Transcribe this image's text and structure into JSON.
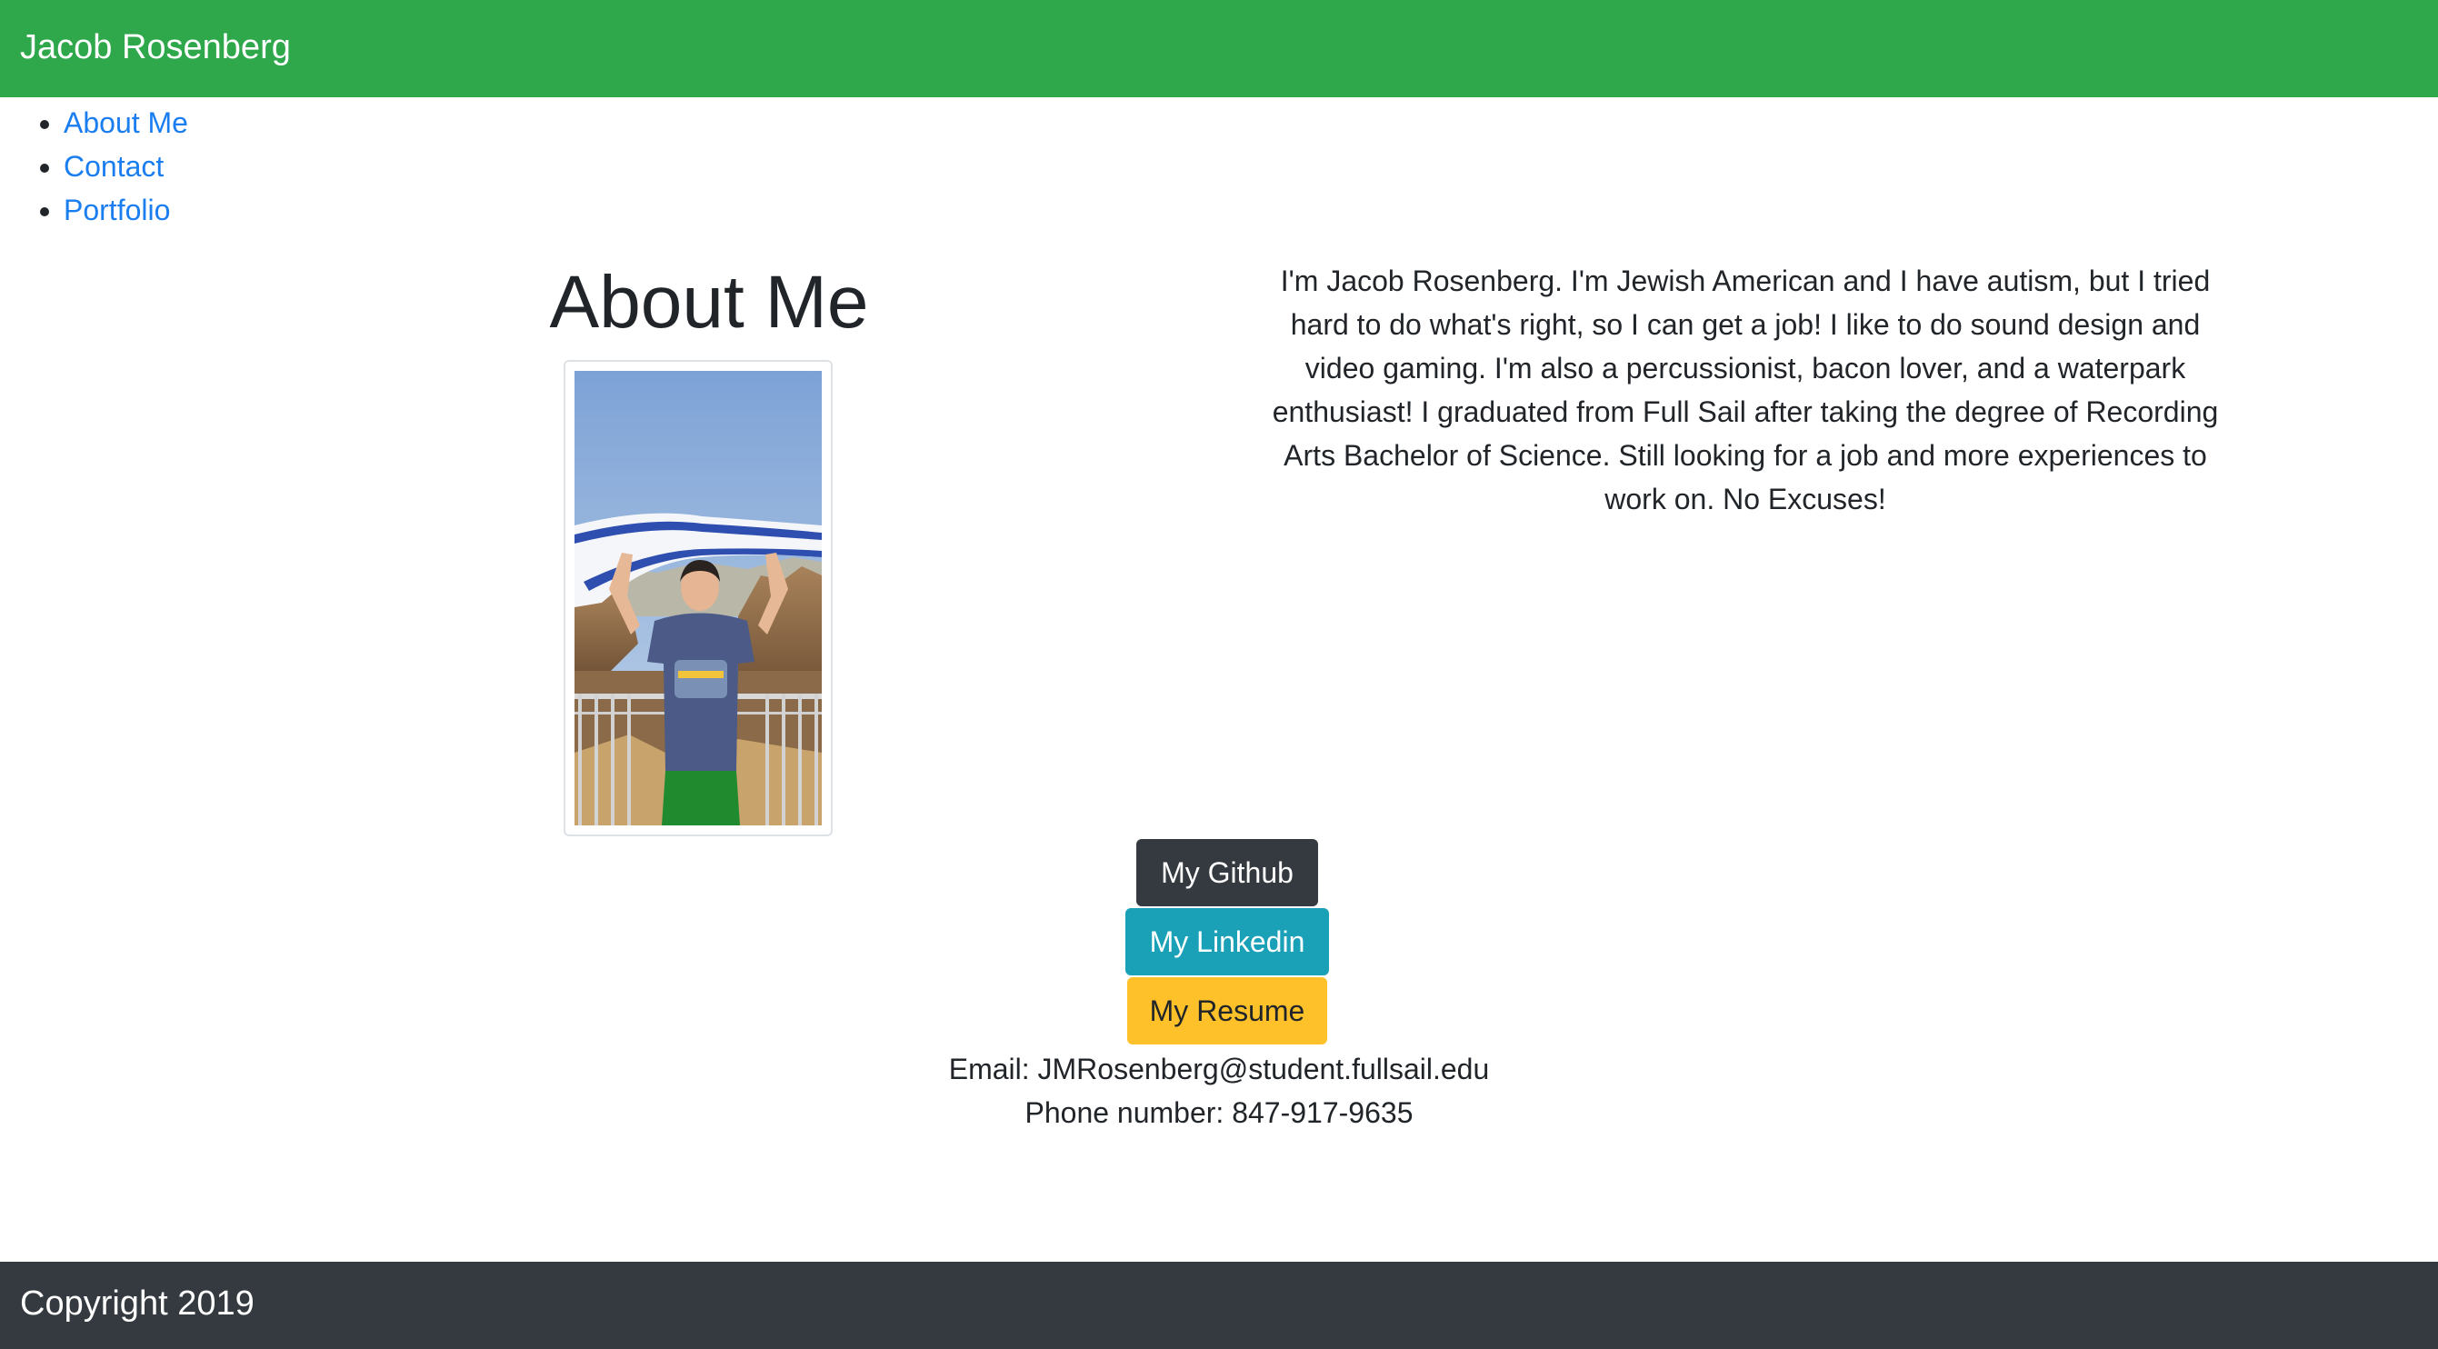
{
  "header": {
    "brand": "Jacob Rosenberg",
    "background_color": "#2fa84c"
  },
  "nav": {
    "items": [
      {
        "label": "About Me"
      },
      {
        "label": "Contact"
      },
      {
        "label": "Portfolio"
      }
    ],
    "link_color": "#1a7ef0"
  },
  "about": {
    "title": "About Me",
    "photo_alt": "photo of person holding a blue and white flag on a rocky overlook",
    "bio": "I'm Jacob Rosenberg. I'm Jewish American and I have autism, but I tried hard to do what's right, so I can get a job! I like to do sound design and video gaming. I'm also a percussionist, bacon lover, and a waterpark enthusiast! I graduated from Full Sail after taking the degree of Recording Arts Bachelor of Science. Still looking for a job and more experiences to work on. No Excuses!"
  },
  "buttons": {
    "github": {
      "label": "My Github",
      "color": "#343a40"
    },
    "linkedin": {
      "label": "My Linkedin",
      "color": "#1aa1b8"
    },
    "resume": {
      "label": "My Resume",
      "color": "#ffc12a"
    }
  },
  "contact": {
    "email": "Email: JMRosenberg@student.fullsail.edu",
    "phone": "Phone number: 847-917-9635"
  },
  "footer": {
    "text": "Copyright 2019",
    "background_color": "#343a40"
  }
}
